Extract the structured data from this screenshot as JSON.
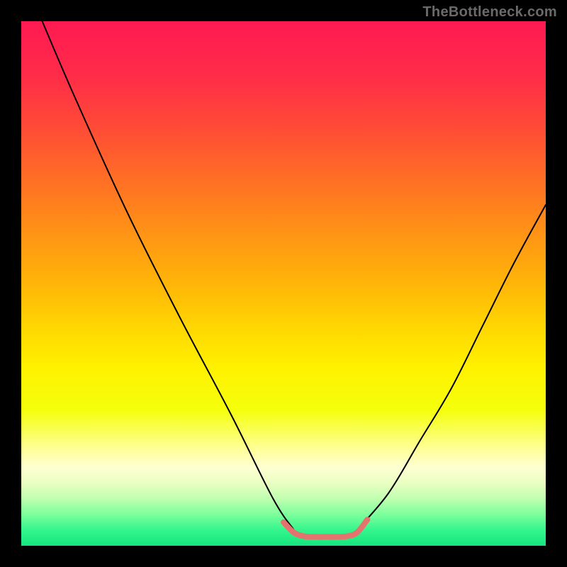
{
  "watermark": "TheBottleneck.com",
  "chart_data": {
    "type": "line",
    "title": "",
    "xlabel": "",
    "ylabel": "",
    "xlim": [
      0,
      100
    ],
    "ylim": [
      0,
      100
    ],
    "grid": false,
    "legend": false,
    "background": "rainbow-gradient",
    "series": [
      {
        "name": "curve-left",
        "stroke": "#000000",
        "stroke_width": 2,
        "x": [
          4,
          10,
          20,
          30,
          40,
          48,
          52
        ],
        "y": [
          100,
          86,
          64,
          44,
          25,
          9,
          3
        ]
      },
      {
        "name": "curve-right",
        "stroke": "#000000",
        "stroke_width": 2,
        "x": [
          64,
          70,
          76,
          82,
          88,
          94,
          100
        ],
        "y": [
          3,
          10,
          20,
          30,
          42,
          54,
          65
        ]
      },
      {
        "name": "bottom-segment",
        "stroke": "#e5736d",
        "stroke_width": 8,
        "x": [
          50,
          52,
          54,
          56,
          58,
          60,
          62,
          64,
          66
        ],
        "y": [
          4.5,
          2.5,
          1.8,
          1.7,
          1.7,
          1.7,
          1.8,
          2.5,
          5
        ]
      }
    ],
    "gradient_stops": [
      {
        "offset": 0.0,
        "color": "#ff1a52"
      },
      {
        "offset": 0.1,
        "color": "#ff2b49"
      },
      {
        "offset": 0.2,
        "color": "#ff4a37"
      },
      {
        "offset": 0.3,
        "color": "#ff6e25"
      },
      {
        "offset": 0.4,
        "color": "#ff9216"
      },
      {
        "offset": 0.5,
        "color": "#ffb508"
      },
      {
        "offset": 0.58,
        "color": "#ffd502"
      },
      {
        "offset": 0.66,
        "color": "#fff100"
      },
      {
        "offset": 0.74,
        "color": "#f5ff0b"
      },
      {
        "offset": 0.82,
        "color": "#ffffa0"
      },
      {
        "offset": 0.85,
        "color": "#ffffd2"
      },
      {
        "offset": 0.88,
        "color": "#eaffc2"
      },
      {
        "offset": 0.91,
        "color": "#c0ffb0"
      },
      {
        "offset": 0.94,
        "color": "#7eff9c"
      },
      {
        "offset": 0.97,
        "color": "#34f58d"
      },
      {
        "offset": 1.0,
        "color": "#16e57e"
      }
    ]
  }
}
